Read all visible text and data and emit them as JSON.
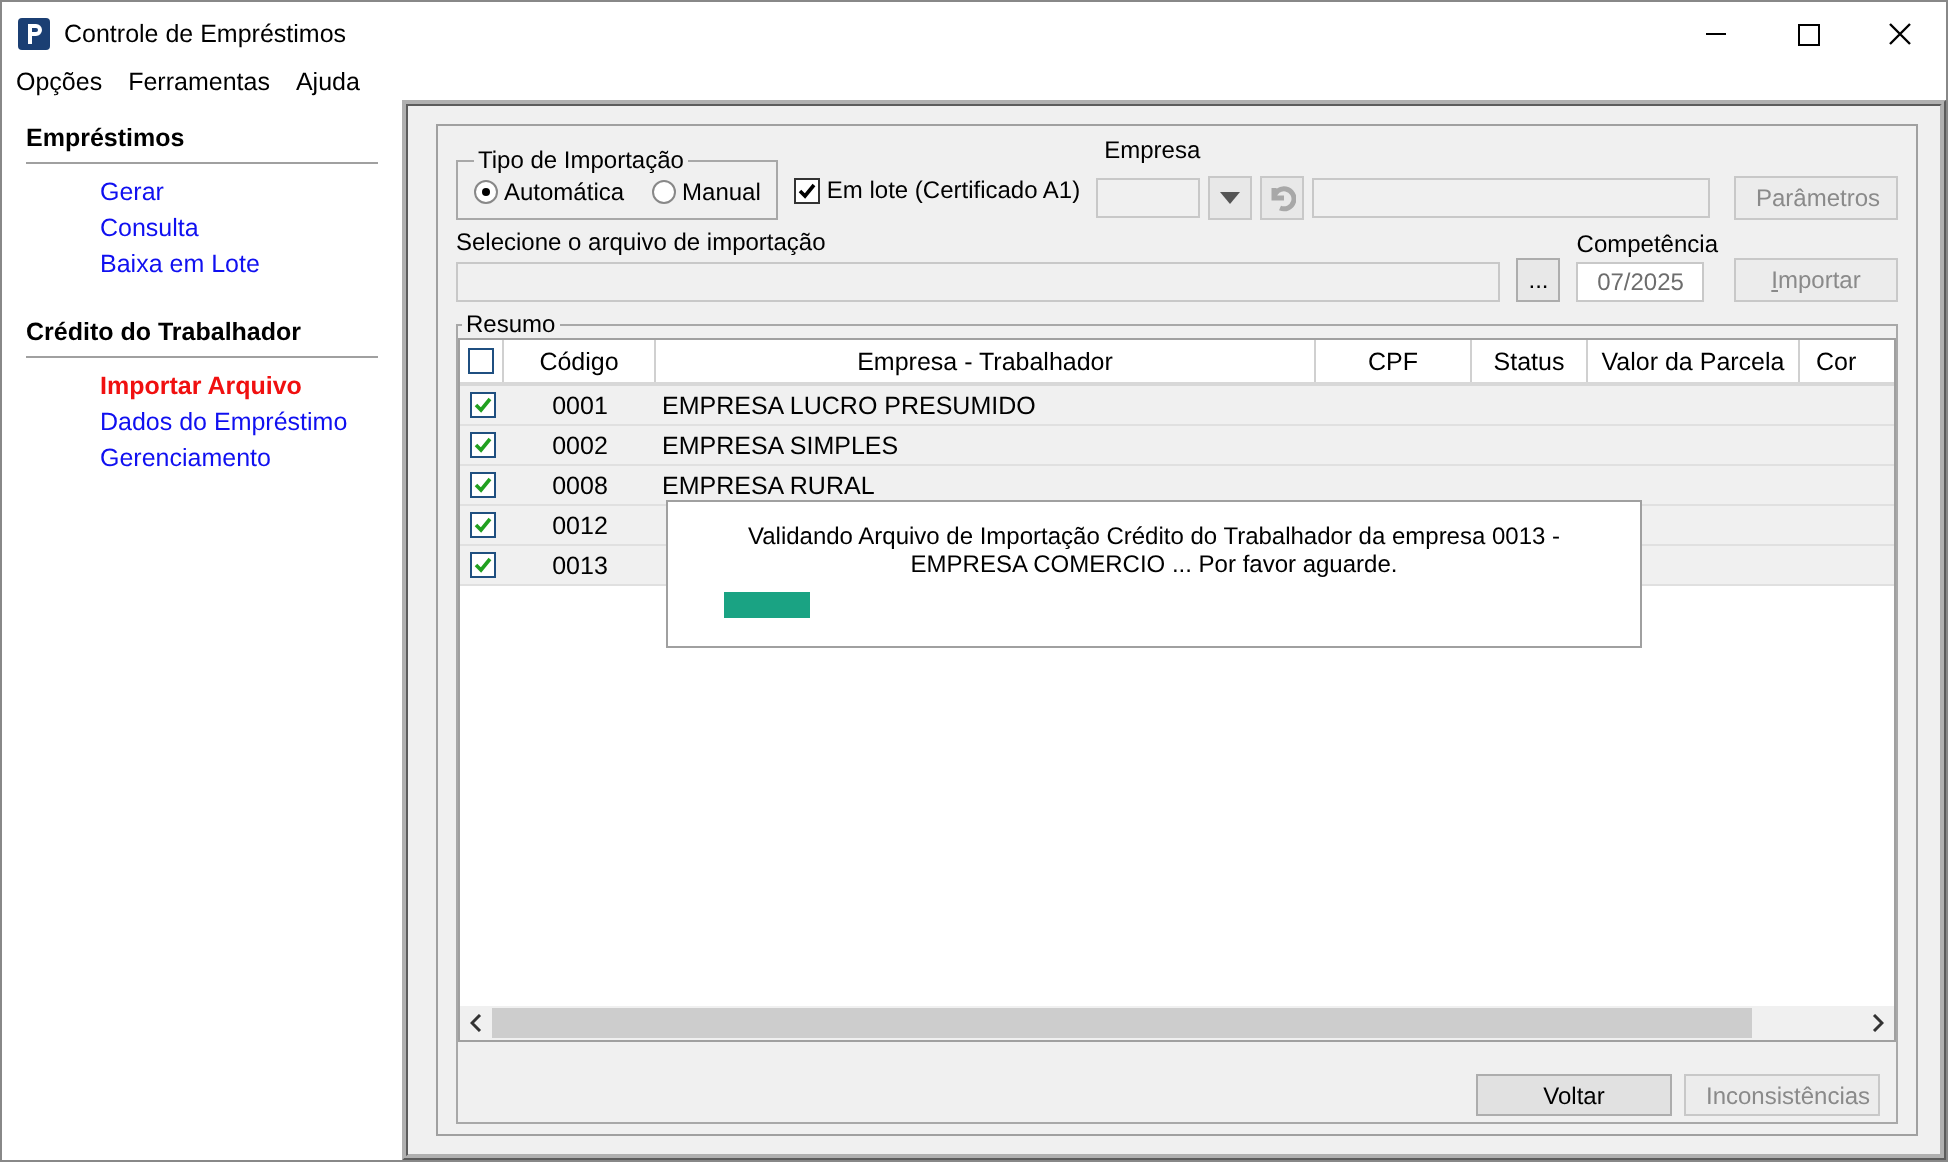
{
  "window": {
    "title": "Controle de Empréstimos"
  },
  "menu": [
    "Opções",
    "Ferramentas",
    "Ajuda"
  ],
  "sidebar": [
    {
      "title": "Empréstimos",
      "items": [
        {
          "label": "Gerar",
          "selected": false
        },
        {
          "label": "Consulta",
          "selected": false
        },
        {
          "label": "Baixa em Lote",
          "selected": false
        }
      ]
    },
    {
      "title": "Crédito do Trabalhador",
      "items": [
        {
          "label": "Importar Arquivo",
          "selected": true
        },
        {
          "label": "Dados do Empréstimo",
          "selected": false
        },
        {
          "label": "Gerenciamento",
          "selected": false
        }
      ]
    }
  ],
  "import_type": {
    "title": "Tipo de Importação",
    "options": [
      {
        "label": "Automática",
        "selected": true
      },
      {
        "label": "Manual",
        "selected": false
      }
    ]
  },
  "batch": {
    "label": "Em lote (Certificado A1)",
    "checked": true
  },
  "empresa": {
    "label": "Empresa"
  },
  "params_button": {
    "label": "Parâmetros",
    "disabled": true
  },
  "file": {
    "label": "Selecione o arquivo de importação",
    "browse": "..."
  },
  "competencia": {
    "label": "Competência",
    "value": "07/2025"
  },
  "import_button": {
    "label": "Importar",
    "disabled": true
  },
  "summary": {
    "title": "Resumo",
    "all_checked": false,
    "columns": [
      "Código",
      "Empresa - Trabalhador",
      "CPF",
      "Status",
      "Valor da Parcela",
      "Cor"
    ],
    "rows": [
      {
        "checked": true,
        "code": "0001",
        "name": "EMPRESA LUCRO PRESUMIDO"
      },
      {
        "checked": true,
        "code": "0002",
        "name": "EMPRESA SIMPLES"
      },
      {
        "checked": true,
        "code": "0008",
        "name": "EMPRESA RURAL"
      },
      {
        "checked": true,
        "code": "0012"
      },
      {
        "checked": true,
        "code": "0013"
      }
    ]
  },
  "progress_dialog": {
    "message": "Validando Arquivo de Importação Crédito do Trabalhador da empresa 0013 - EMPRESA COMERCIO ... Por favor aguarde.",
    "level": 0.1
  },
  "buttons": [
    {
      "label": "Voltar",
      "disabled": false
    },
    {
      "label": "Inconsistências",
      "disabled": true
    }
  ]
}
